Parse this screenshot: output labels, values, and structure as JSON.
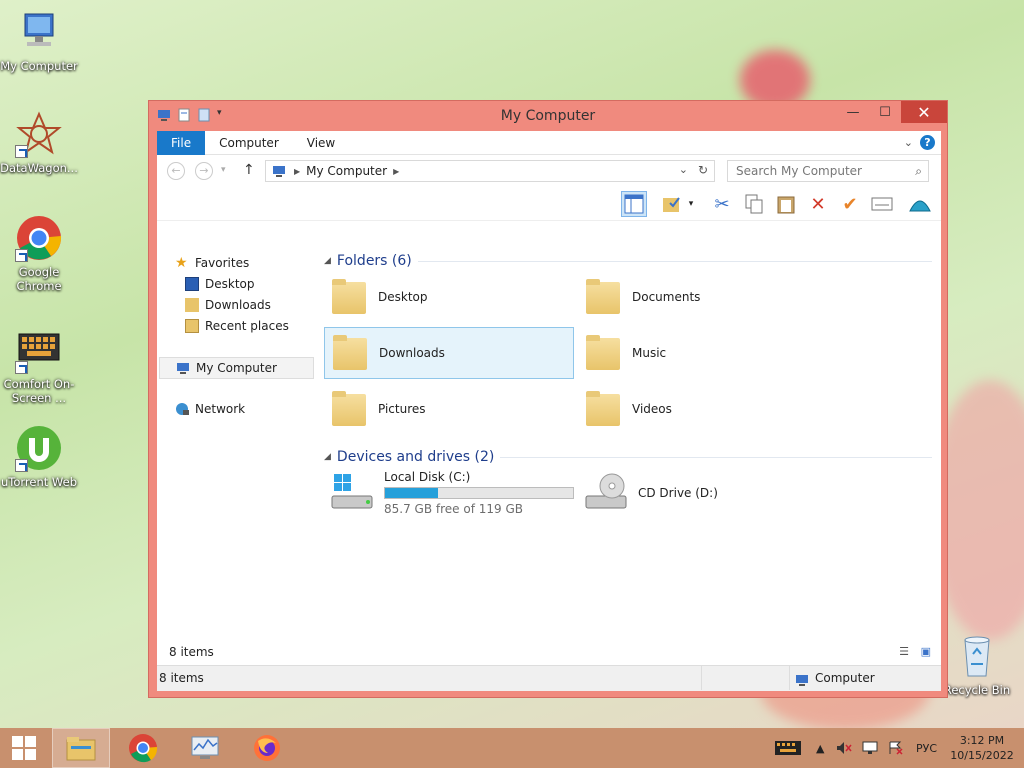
{
  "desktop": {
    "icons": [
      {
        "label": "My Computer"
      },
      {
        "label": "DataWagon..."
      },
      {
        "label": "Google Chrome"
      },
      {
        "label": "Comfort On-Screen ..."
      },
      {
        "label": "uTorrent Web"
      },
      {
        "label": "Recycle Bin"
      }
    ]
  },
  "window": {
    "title": "My Computer",
    "ribbon_tabs": [
      "File",
      "Computer",
      "View"
    ],
    "address": {
      "crumb": "My Computer"
    },
    "search": {
      "placeholder": "Search My Computer"
    },
    "nav": {
      "favorites": "Favorites",
      "items": [
        "Desktop",
        "Downloads",
        "Recent places"
      ],
      "computer": "My Computer",
      "network": "Network"
    },
    "groups": {
      "folders": "Folders (6)",
      "devices": "Devices and drives (2)"
    },
    "folders": [
      "Desktop",
      "Documents",
      "Downloads",
      "Music",
      "Pictures",
      "Videos"
    ],
    "drives": {
      "c": {
        "name": "Local Disk (C:)",
        "free": "85.7 GB free of 119 GB",
        "used_fraction": 0.28
      },
      "d": {
        "name": "CD Drive (D:)"
      }
    },
    "status_items": "8 items",
    "statusbar": {
      "items": "8 items",
      "location": "Computer"
    }
  },
  "taskbar": {
    "lang": "РУС",
    "time": "3:12 PM",
    "date": "10/15/2022"
  },
  "colors": {
    "accent": "#1979ca",
    "frame": "#f08a7e",
    "taskbar": "#c8906e"
  }
}
